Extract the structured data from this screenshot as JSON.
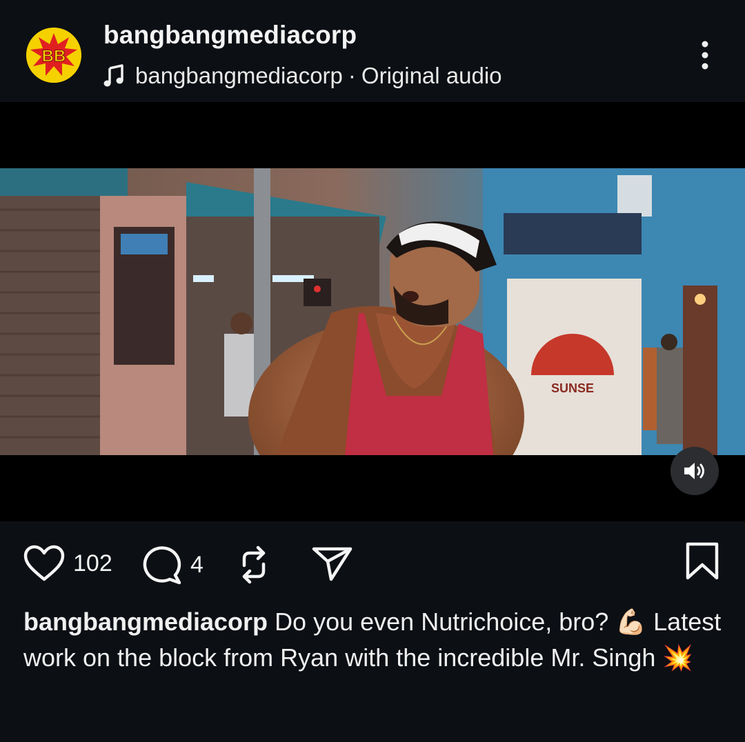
{
  "post": {
    "username": "bangbangmediacorp",
    "avatar_text": "BB",
    "audio": {
      "icon": "music-note-icon",
      "artist": "bangbangmediacorp",
      "separator": "·",
      "label": "Original audio"
    },
    "more_icon": "more-vertical-icon"
  },
  "media": {
    "sound_icon": "speaker-on-icon",
    "signage_text": "SUNSE"
  },
  "actions": {
    "like": {
      "icon": "heart-icon",
      "count": "102"
    },
    "comment": {
      "icon": "comment-icon",
      "count": "4"
    },
    "repost": {
      "icon": "repost-icon"
    },
    "share": {
      "icon": "send-icon"
    },
    "save": {
      "icon": "bookmark-icon"
    }
  },
  "caption": {
    "username": "bangbangmediacorp",
    "text": "Do you even Nutrichoice, bro? 💪🏻 Latest work on the block from Ryan with the incredible Mr. Singh 💥"
  },
  "colors": {
    "background": "#0c0f14",
    "media_background": "#000000",
    "avatar_yellow": "#f5d100",
    "avatar_red": "#e02020"
  }
}
